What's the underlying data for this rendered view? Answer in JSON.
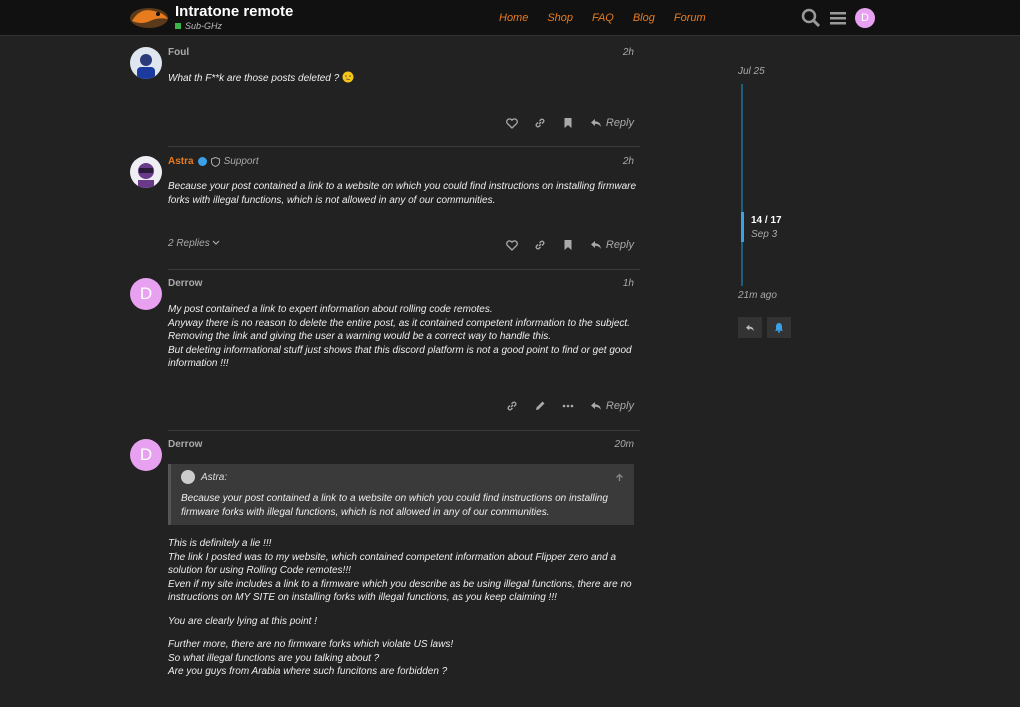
{
  "header": {
    "title": "Intratone remote",
    "category": "Sub-GHz",
    "nav": [
      "Home",
      "Shop",
      "FAQ",
      "Blog",
      "Forum"
    ],
    "user_initial": "D"
  },
  "posts": [
    {
      "user": "Foul",
      "time": "2h",
      "body": [
        "What th F**k are those posts deleted ?"
      ],
      "reply_label": "Reply"
    },
    {
      "user": "Astra",
      "role": "Support",
      "time": "2h",
      "body": [
        "Because your post contained a link to a website on which you could find instructions on installing firmware forks with illegal functions, which is not allowed in any of our communities."
      ],
      "replies": "2 Replies",
      "reply_label": "Reply"
    },
    {
      "user": "Derrow",
      "initial": "D",
      "time": "1h",
      "body": [
        "My post contained a link to expert information about rolling code remotes.",
        "Anyway there is no reason to delete the entire post, as it contained competent information to the subject.",
        "Removing the link and giving the user a warning would be a correct way to handle this.",
        "But deleting informational stuff just shows that this discord platform is not a good point to find or get good information !!!"
      ],
      "reply_label": "Reply"
    },
    {
      "user": "Derrow",
      "initial": "D",
      "time": "20m",
      "quote_author": "Astra:",
      "quote_body": "Because your post contained a link to a website on which you could find instructions on installing firmware forks with illegal functions, which is not allowed in any of our communities.",
      "para1": [
        "This is definitely a lie !!!",
        "The link I posted was to my website, which contained competent information about Flipper zero and a solution for using Rolling Code remotes!!!",
        "Even if my site includes a link to a firmware which you describe as be using illegal functions, there are no instructions on MY SITE on installing forks with illegal functions, as you keep claiming !!!"
      ],
      "para2": "You are clearly lying at this point !",
      "para3": [
        "Further more, there are no firmware forks which violate US laws!",
        "So what illegal functions are you talking about ?",
        "Are you guys from Arabia where such funcitons are forbidden ?"
      ]
    }
  ],
  "timeline": {
    "start": "Jul 25",
    "position": "14 / 17",
    "position_date": "Sep 3",
    "end": "21m ago"
  },
  "colors": {
    "accent": "#e87b1e",
    "background": "#222222",
    "link_blue": "#3aa0e8"
  }
}
